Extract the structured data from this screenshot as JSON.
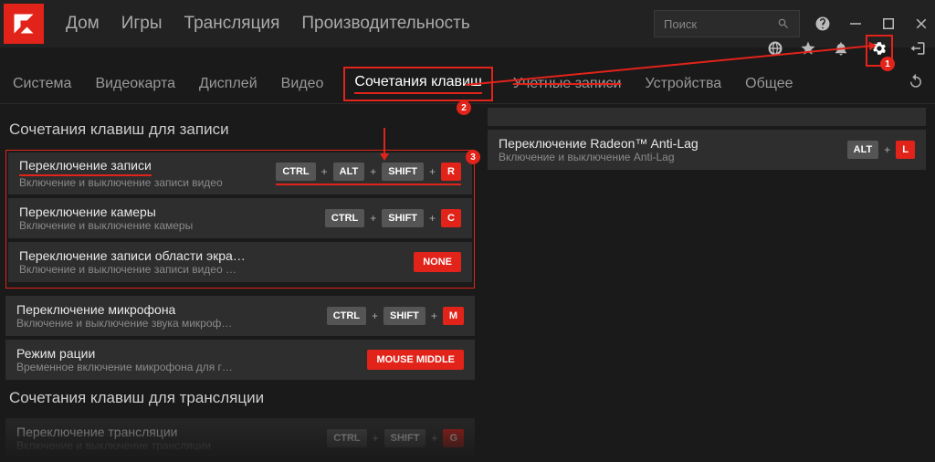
{
  "titlebar": {
    "nav": [
      "Дом",
      "Игры",
      "Трансляция",
      "Производительность"
    ],
    "search_placeholder": "Поиск"
  },
  "subnav": {
    "tabs": [
      "Система",
      "Видеокарта",
      "Дисплей",
      "Видео",
      "Сочетания клавиш",
      "Учетные записи",
      "Устройства",
      "Общее"
    ],
    "active_index": 4,
    "struck_index": 5
  },
  "sections": {
    "recording_title": "Сочетания клавиш для записи",
    "streaming_title": "Сочетания клавиш для трансляции"
  },
  "rows": {
    "rec0": {
      "title": "Переключение записи",
      "sub": "Включение и выключение записи видео",
      "keys": [
        "CTRL",
        "ALT",
        "SHIFT"
      ],
      "fin": "R"
    },
    "rec1": {
      "title": "Переключение камеры",
      "sub": "Включение и выключение камеры",
      "keys": [
        "CTRL",
        "SHIFT"
      ],
      "fin": "C"
    },
    "rec2": {
      "title": "Переключение записи области экра…",
      "sub": "Включение и выключение записи видео …",
      "btn": "NONE"
    },
    "rec3": {
      "title": "Переключение микрофона",
      "sub": "Включение и выключение звука микроф…",
      "keys": [
        "CTRL",
        "SHIFT"
      ],
      "fin": "M"
    },
    "rec4": {
      "title": "Режим рации",
      "sub": "Временное включение микрофона для г…",
      "btn": "MOUSE MIDDLE"
    },
    "str0": {
      "title": "Переключение трансляции",
      "sub": "Включение и выключение трансляции",
      "keys": [
        "CTRL",
        "SHIFT"
      ],
      "fin": "G"
    },
    "side0": {
      "title": "Переключение Radeon™ Anti-Lag",
      "sub": "Включение и выключение Anti-Lag",
      "keys": [
        "ALT"
      ],
      "fin": "L"
    }
  },
  "annotations": {
    "n1": "1",
    "n2": "2",
    "n3": "3"
  }
}
